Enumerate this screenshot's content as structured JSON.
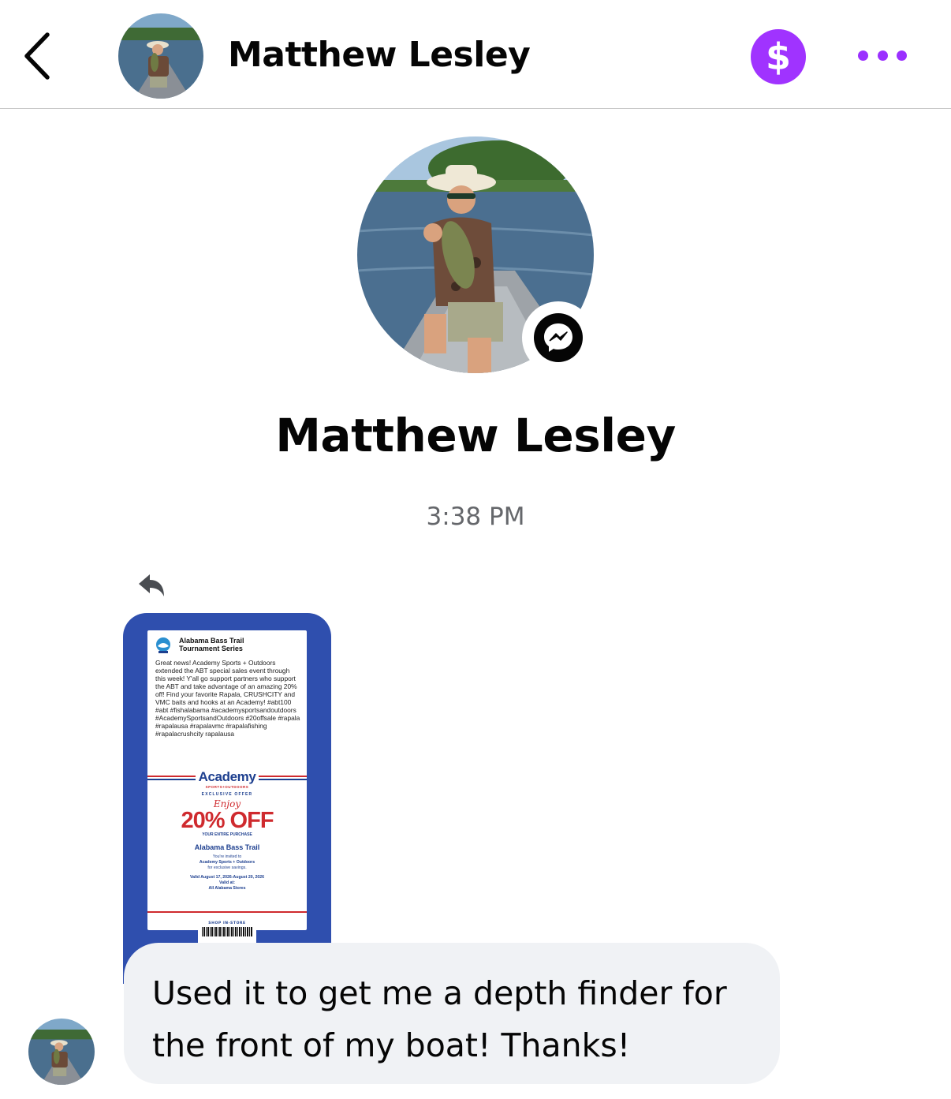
{
  "header": {
    "title": "Matthew Lesley",
    "back_icon": "chevron-left-icon",
    "pay_icon": "dollar-icon",
    "more_icon": "more-dots-icon"
  },
  "profile": {
    "name": "Matthew Lesley",
    "badge_icon": "messenger-icon"
  },
  "thread": {
    "timestamp": "3:38 PM",
    "reply_icon": "reply-icon",
    "shared_post": {
      "page_name": "Alabama Bass Trail Tournament Series",
      "text": "Great news! Academy Sports + Outdoors extended the ABT special sales event through this week! Y'all go support partners who support the ABT and take advantage of an amazing 20% off! Find your favorite Rapala, CRUSHCITY and VMC baits and hooks at an Academy! #abt100 #abt #fishalabama #academysportsandoutdoors #AcademySportsandOutdoors #20offsale #rapala #rapalausa #rapalavmc #rapalafishing #rapalacrushcity rapalausa",
      "ad": {
        "brand": "Academy",
        "brand_sub": "SPORTS+OUTDOORS",
        "exclusive": "EXCLUSIVE OFFER",
        "enjoy": "Enjoy",
        "discount": "20% OFF",
        "discount_sub": "YOUR ENTIRE PURCHASE",
        "audience": "Alabama Bass Trail",
        "invite_1": "You're invited to",
        "invite_2": "Academy Sports + Outdoors",
        "invite_3": "for exclusive savings.",
        "valid_dates": "Valid August 17, 2026-August 20, 2026",
        "valid_at": "Valid at:",
        "stores": "All Alabama Stores",
        "shop": "SHOP IN-STORE"
      }
    },
    "message": "Used it to get me a depth finder for the front of my boat! Thanks!"
  },
  "colors": {
    "pay_button": "#a033ff",
    "more_dots": "#9b30ff",
    "card_border": "#2f4fae",
    "bubble": "#f0f2f5",
    "timestamp": "#65676b"
  }
}
